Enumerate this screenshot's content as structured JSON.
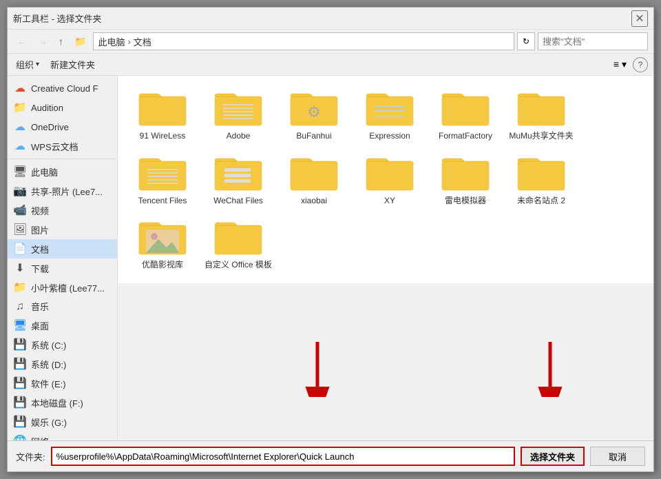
{
  "dialog": {
    "title": "新工具栏 - 选择文件夹",
    "close_btn": "✕"
  },
  "toolbar": {
    "back_btn": "←",
    "forward_btn": "→",
    "up_btn": "↑",
    "folder_btn": "📁"
  },
  "address": {
    "parts": [
      "此电脑",
      "›",
      "文档"
    ],
    "search_placeholder": "搜索\"文档\""
  },
  "action_toolbar": {
    "organize_btn": "组织",
    "organize_arrow": "▾",
    "new_folder_btn": "新建文件夹"
  },
  "sidebar": {
    "items": [
      {
        "id": "creative-cloud",
        "icon": "☁",
        "label": "Creative Cloud F",
        "icon_color": "#e34f26"
      },
      {
        "id": "audition",
        "icon": "📁",
        "label": "Audition",
        "icon_color": "#f0c040"
      },
      {
        "id": "onedrive",
        "icon": "☁",
        "label": "OneDrive",
        "icon_color": "#5badf0"
      },
      {
        "id": "wps-cloud",
        "icon": "☁",
        "label": "WPS云文档",
        "icon_color": "#5badf0"
      },
      {
        "id": "this-pc",
        "icon": "🖥",
        "label": "此电脑",
        "icon_color": "#555"
      },
      {
        "id": "shared-photos",
        "icon": "📷",
        "label": "共享-照片 (Lee7...",
        "icon_color": "#555"
      },
      {
        "id": "video",
        "icon": "📹",
        "label": "视频",
        "icon_color": "#555"
      },
      {
        "id": "pictures",
        "icon": "🖼",
        "label": "图片",
        "icon_color": "#555"
      },
      {
        "id": "documents",
        "icon": "📄",
        "label": "文档",
        "icon_color": "#0078d7",
        "selected": true
      },
      {
        "id": "downloads",
        "icon": "⬇",
        "label": "下载",
        "icon_color": "#555"
      },
      {
        "id": "xiaoyezi",
        "icon": "📁",
        "label": "小叶紫檀 (Lee77...",
        "icon_color": "#f0c040"
      },
      {
        "id": "music",
        "icon": "♫",
        "label": "音乐",
        "icon_color": "#555"
      },
      {
        "id": "desktop",
        "icon": "🖥",
        "label": "桌面",
        "icon_color": "#1e90ff"
      },
      {
        "id": "system-c",
        "icon": "💾",
        "label": "系统 (C:)",
        "icon_color": "#555"
      },
      {
        "id": "system-d",
        "icon": "💾",
        "label": "系统 (D:)",
        "icon_color": "#555"
      },
      {
        "id": "software-e",
        "icon": "💾",
        "label": "软件 (E:)",
        "icon_color": "#555"
      },
      {
        "id": "local-f",
        "icon": "💾",
        "label": "本地磁盘 (F:)",
        "icon_color": "#555"
      },
      {
        "id": "entertainment-g",
        "icon": "💾",
        "label": "娱乐 (G:)",
        "icon_color": "#555"
      },
      {
        "id": "network",
        "icon": "🌐",
        "label": "网络",
        "icon_color": "#555"
      }
    ]
  },
  "files": [
    {
      "id": "f1",
      "name": "91 WireLess",
      "type": "folder",
      "variant": "plain"
    },
    {
      "id": "f2",
      "name": "Adobe",
      "type": "folder",
      "variant": "lined"
    },
    {
      "id": "f3",
      "name": "BuFanhui",
      "type": "folder",
      "variant": "gears"
    },
    {
      "id": "f4",
      "name": "Expression",
      "type": "folder",
      "variant": "lined2"
    },
    {
      "id": "f5",
      "name": "FormatFactory",
      "type": "folder",
      "variant": "plain"
    },
    {
      "id": "f6",
      "name": "MuMu共享文件夹",
      "type": "folder",
      "variant": "plain"
    },
    {
      "id": "f7",
      "name": "Tencent Files",
      "type": "folder",
      "variant": "lined"
    },
    {
      "id": "f8",
      "name": "WeChat Files",
      "type": "folder",
      "variant": "lined3"
    },
    {
      "id": "f9",
      "name": "xiaobai",
      "type": "folder",
      "variant": "plain"
    },
    {
      "id": "f10",
      "name": "XY",
      "type": "folder",
      "variant": "plain"
    },
    {
      "id": "f11",
      "name": "雷电模拟器",
      "type": "folder",
      "variant": "plain"
    },
    {
      "id": "f12",
      "name": "未命名站点 2",
      "type": "folder",
      "variant": "plain"
    },
    {
      "id": "f13",
      "name": "优酷影视库",
      "type": "folder",
      "variant": "photo"
    },
    {
      "id": "f14",
      "name": "自定义 Office 模板",
      "type": "folder",
      "variant": "plain"
    }
  ],
  "bottom": {
    "label": "文件夹:",
    "input_value": "%userprofile%\\AppData\\Roaming\\Microsoft\\Internet Explorer\\Quick Launch",
    "select_btn": "选择文件夹",
    "cancel_btn": "取消"
  },
  "view": {
    "view_icon": "≡",
    "view_arrow": "▾",
    "help": "?"
  }
}
